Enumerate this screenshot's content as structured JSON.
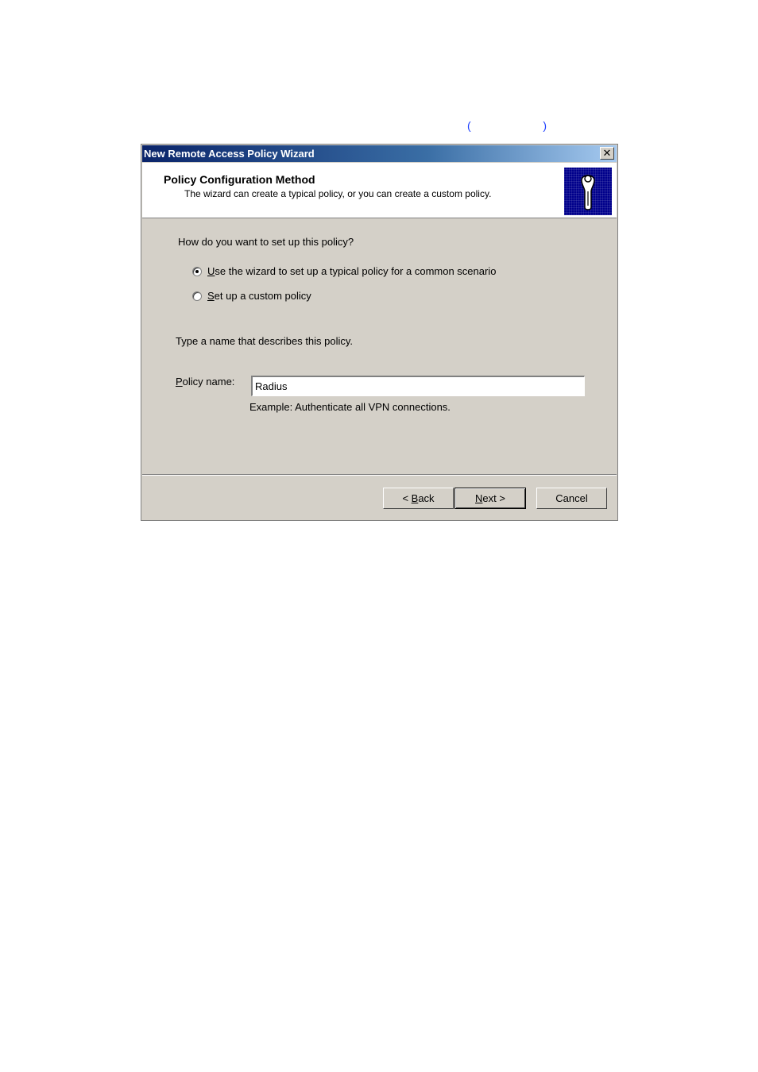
{
  "page": {
    "paren_open": "(",
    "paren_close": ")"
  },
  "dialog": {
    "title": "New Remote Access Policy Wizard",
    "close_glyph": "✕",
    "header": {
      "title": "Policy Configuration Method",
      "subtitle": "The wizard can create a typical policy, or you can create a custom policy.",
      "icon": "remote-access-policy-icon"
    },
    "question": "How do you want to set up this policy?",
    "options": [
      {
        "accel": "U",
        "rest": "se the wizard to set up a typical policy for a common scenario",
        "selected": true
      },
      {
        "accel": "S",
        "rest": "et up a custom policy",
        "selected": false
      }
    ],
    "name_prompt": "Type a name that describes this policy.",
    "policy_name": {
      "label_accel": "P",
      "label_rest": "olicy name:",
      "value": "Radius",
      "example": "Example: Authenticate all VPN connections."
    },
    "buttons": {
      "back_prefix": "< ",
      "back_accel": "B",
      "back_rest": "ack",
      "next_accel": "N",
      "next_rest": "ext >",
      "cancel": "Cancel"
    }
  }
}
